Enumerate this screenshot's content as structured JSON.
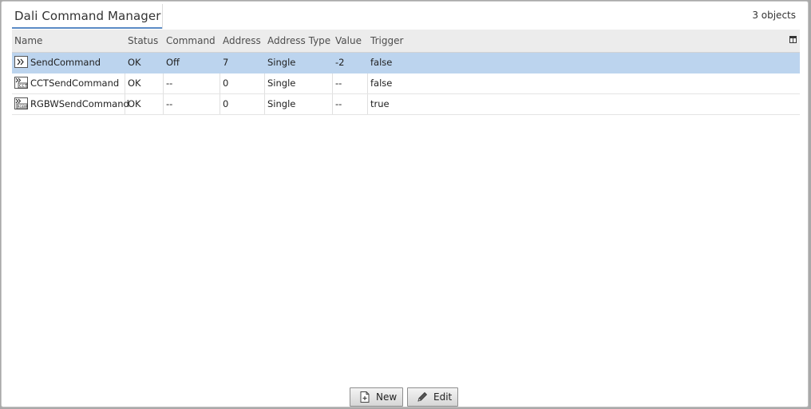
{
  "view": {
    "title": "Dali Command Manager",
    "object_count": "3 objects"
  },
  "table": {
    "columns": [
      "Name",
      "Status",
      "Command",
      "Address",
      "Address Type",
      "Value",
      "Trigger"
    ],
    "rows": [
      {
        "icon": "send-command-icon",
        "name": "SendCommand",
        "status": "OK",
        "command": "Off",
        "address": "7",
        "address_type": "Single",
        "value": "-2",
        "trigger": "false",
        "selected": true
      },
      {
        "icon": "cct-send-command-icon",
        "name": "CCTSendCommand",
        "status": "OK",
        "command": "--",
        "address": "0",
        "address_type": "Single",
        "value": "--",
        "trigger": "false",
        "selected": false
      },
      {
        "icon": "rgbw-send-command-icon",
        "name": "RGBWSendCommand",
        "status": "OK",
        "command": "--",
        "address": "0",
        "address_type": "Single",
        "value": "--",
        "trigger": "true",
        "selected": false
      }
    ]
  },
  "actions": {
    "new_label": "New",
    "new_icon": "new-document-icon",
    "edit_label": "Edit",
    "edit_icon": "pencil-icon"
  },
  "colors": {
    "selection": "#bcd4ee",
    "tab_underline": "#5b8bc5"
  }
}
